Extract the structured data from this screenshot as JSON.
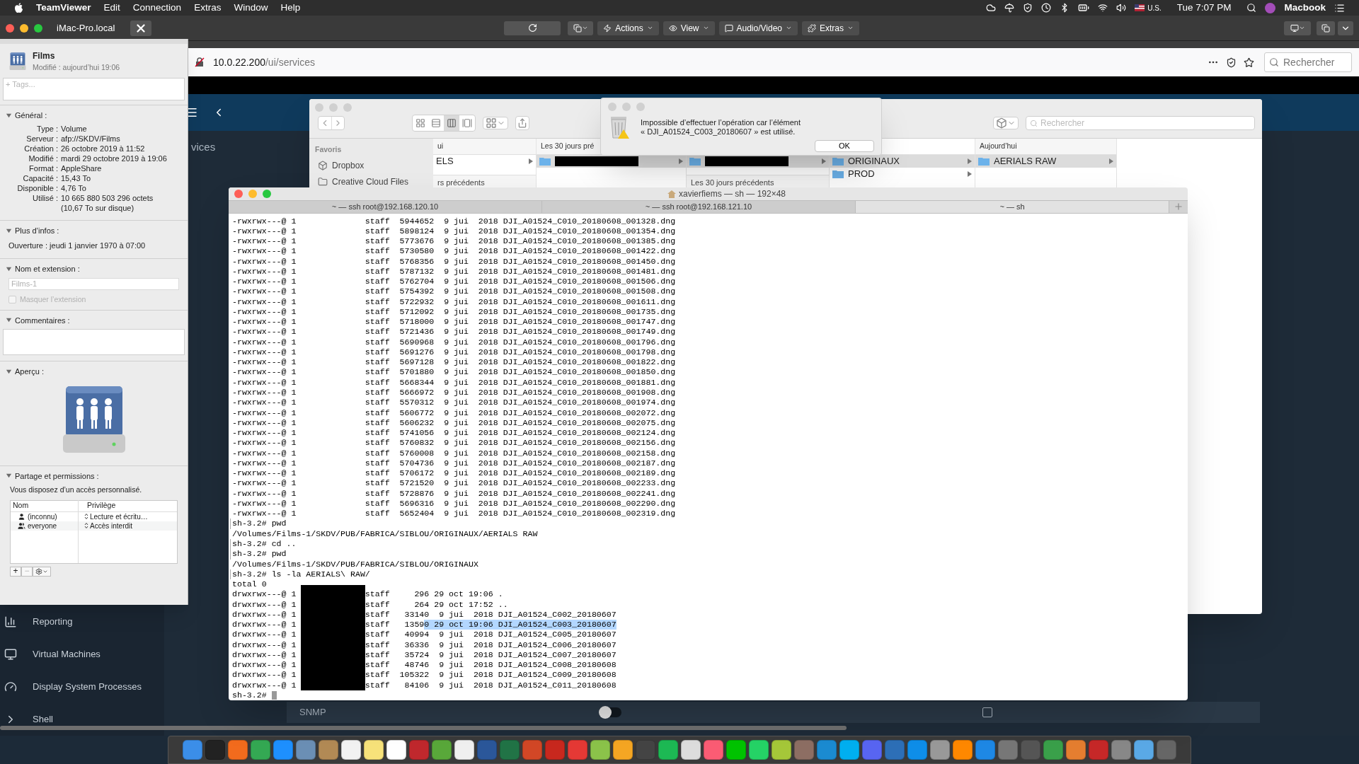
{
  "menubar": {
    "app": "TeamViewer",
    "menus": [
      "Edit",
      "Connection",
      "Extras",
      "Window",
      "Help"
    ],
    "input_source": "U.S.",
    "clock": "Tue 7:07 PM",
    "user": "Macbook"
  },
  "teamviewer": {
    "session_tab": "iMac-Pro.local",
    "actions": [
      "Actions",
      "View",
      "Audio/Video",
      "Extras"
    ]
  },
  "browser": {
    "url_host": "10.0.22.200",
    "url_path": "/ui/services",
    "search_placeholder": "Rechercher"
  },
  "web_app": {
    "page_title": "vices",
    "sidebar": [
      {
        "label": "Reporting"
      },
      {
        "label": "Virtual Machines"
      },
      {
        "label": "Display System Processes"
      },
      {
        "label": "Shell"
      }
    ],
    "snmp_label": "SNMP",
    "snmp_on": false,
    "snmp_checked": false
  },
  "info_window": {
    "name": "Films",
    "modified": "Modifié : aujourd’hui 19:06",
    "tags_placeholder": "+ Tags...",
    "general": {
      "title": "Général :",
      "expanded": true,
      "rows": [
        {
          "label": "Type :",
          "value": "Volume"
        },
        {
          "label": "Serveur :",
          "value": "afp://SKDV/Films"
        },
        {
          "label": "Création :",
          "value": "26 octobre 2019 à 11:52"
        },
        {
          "label": "Modifié :",
          "value": "mardi 29 octobre 2019 à 19:06"
        },
        {
          "label": "Format :",
          "value": "AppleShare"
        },
        {
          "label": "Capacité :",
          "value": "15,43 To"
        },
        {
          "label": "Disponible :",
          "value": "4,76 To"
        },
        {
          "label": "Utilisé :",
          "value": "10 665 880 503 296 octets"
        },
        {
          "value": "(10,67 To sur disque)"
        }
      ]
    },
    "more": {
      "title": "Plus d’infos :",
      "expanded": true,
      "text": "Ouverture : jeudi 1 janvier 1970 à 07:00"
    },
    "name_ext": {
      "title": "Nom et extension :",
      "expanded": true,
      "field_value": "Films-1",
      "hide_label": "Masquer l’extension",
      "hide_checked": false
    },
    "comments": {
      "title": "Commentaires :",
      "expanded": true
    },
    "preview": {
      "title": "Aperçu :",
      "expanded": true
    },
    "sharing": {
      "title": "Partage et permissions :",
      "expanded": true,
      "note": "Vous disposez d’un accès personnalisé.",
      "columns": [
        "Nom",
        "Privilège"
      ],
      "rows": [
        {
          "name": "(inconnu)",
          "privilege": "Lecture et écritu…",
          "kind": "user"
        },
        {
          "name": "everyone",
          "privilege": "Accès interdit",
          "kind": "group"
        }
      ],
      "buttons": [
        "+",
        "−"
      ]
    }
  },
  "finder": {
    "sidebar_heading": "Favoris",
    "sidebar_items": [
      {
        "label": "Dropbox"
      },
      {
        "label": "Creative Cloud Files"
      }
    ],
    "search_placeholder": "Rechercher",
    "columns": [
      {
        "header": "ui",
        "items": [
          {
            "label": "ELS",
            "selected": false
          }
        ],
        "subheader": "rs précédents"
      },
      {
        "header": "Les 30 jours pré",
        "items": [
          {
            "redacted": true,
            "selected": true
          }
        ]
      },
      {
        "items": [
          {
            "redacted": true,
            "selected": true
          }
        ],
        "subheader": "Les 30 jours précédents"
      },
      {
        "items": [
          {
            "label": "ORIGINAUX",
            "selected": true
          },
          {
            "label": "PROD",
            "selected": false
          }
        ]
      },
      {
        "header": "Aujourd’hui",
        "items": [
          {
            "label": "AERIALS RAW",
            "selected": true
          }
        ]
      }
    ]
  },
  "alert": {
    "message": "Impossible d’effectuer l’opération car l’élément\n« DJI_A01524_C003_20180607 » est utilisé.",
    "button": "OK"
  },
  "terminal": {
    "title": "xavierfiems — sh — 192×48",
    "tabs": [
      {
        "label": "~ — ssh root@192.168.120.10",
        "selected": false
      },
      {
        "label": "~ — ssh root@192.168.121.10",
        "selected": false
      },
      {
        "label": "~ — sh",
        "selected": true
      }
    ],
    "lines": [
      {
        "kind": "out",
        "text": "-rwxrwx---@ 1              staff  5944652  9 jui  2018 DJI_A01524_C010_20180608_001328.dng"
      },
      {
        "kind": "out",
        "text": "-rwxrwx---@ 1              staff  5898124  9 jui  2018 DJI_A01524_C010_20180608_001354.dng"
      },
      {
        "kind": "out",
        "text": "-rwxrwx---@ 1              staff  5773676  9 jui  2018 DJI_A01524_C010_20180608_001385.dng"
      },
      {
        "kind": "out",
        "text": "-rwxrwx---@ 1              staff  5730580  9 jui  2018 DJI_A01524_C010_20180608_001422.dng"
      },
      {
        "kind": "out",
        "text": "-rwxrwx---@ 1              staff  5768356  9 jui  2018 DJI_A01524_C010_20180608_001450.dng"
      },
      {
        "kind": "out",
        "text": "-rwxrwx---@ 1              staff  5787132  9 jui  2018 DJI_A01524_C010_20180608_001481.dng"
      },
      {
        "kind": "out",
        "text": "-rwxrwx---@ 1              staff  5762704  9 jui  2018 DJI_A01524_C010_20180608_001506.dng"
      },
      {
        "kind": "out",
        "text": "-rwxrwx---@ 1              staff  5754392  9 jui  2018 DJI_A01524_C010_20180608_001508.dng"
      },
      {
        "kind": "out",
        "text": "-rwxrwx---@ 1              staff  5722932  9 jui  2018 DJI_A01524_C010_20180608_001611.dng"
      },
      {
        "kind": "out",
        "text": "-rwxrwx---@ 1              staff  5712092  9 jui  2018 DJI_A01524_C010_20180608_001735.dng"
      },
      {
        "kind": "out",
        "text": "-rwxrwx---@ 1              staff  5718000  9 jui  2018 DJI_A01524_C010_20180608_001747.dng"
      },
      {
        "kind": "out",
        "text": "-rwxrwx---@ 1              staff  5721436  9 jui  2018 DJI_A01524_C010_20180608_001749.dng"
      },
      {
        "kind": "out",
        "text": "-rwxrwx---@ 1              staff  5690968  9 jui  2018 DJI_A01524_C010_20180608_001796.dng"
      },
      {
        "kind": "out",
        "text": "-rwxrwx---@ 1              staff  5691276  9 jui  2018 DJI_A01524_C010_20180608_001798.dng"
      },
      {
        "kind": "out",
        "text": "-rwxrwx---@ 1              staff  5697128  9 jui  2018 DJI_A01524_C010_20180608_001822.dng"
      },
      {
        "kind": "out",
        "text": "-rwxrwx---@ 1              staff  5701880  9 jui  2018 DJI_A01524_C010_20180608_001850.dng"
      },
      {
        "kind": "out",
        "text": "-rwxrwx---@ 1              staff  5668344  9 jui  2018 DJI_A01524_C010_20180608_001881.dng"
      },
      {
        "kind": "out",
        "text": "-rwxrwx---@ 1              staff  5666972  9 jui  2018 DJI_A01524_C010_20180608_001908.dng"
      },
      {
        "kind": "out",
        "text": "-rwxrwx---@ 1              staff  5570312  9 jui  2018 DJI_A01524_C010_20180608_001974.dng"
      },
      {
        "kind": "out",
        "text": "-rwxrwx---@ 1              staff  5606772  9 jui  2018 DJI_A01524_C010_20180608_002072.dng"
      },
      {
        "kind": "out",
        "text": "-rwxrwx---@ 1              staff  5606232  9 jui  2018 DJI_A01524_C010_20180608_002075.dng"
      },
      {
        "kind": "out",
        "text": "-rwxrwx---@ 1              staff  5741056  9 jui  2018 DJI_A01524_C010_20180608_002124.dng"
      },
      {
        "kind": "out",
        "text": "-rwxrwx---@ 1              staff  5760832  9 jui  2018 DJI_A01524_C010_20180608_002156.dng"
      },
      {
        "kind": "out",
        "text": "-rwxrwx---@ 1              staff  5760008  9 jui  2018 DJI_A01524_C010_20180608_002158.dng"
      },
      {
        "kind": "out",
        "text": "-rwxrwx---@ 1              staff  5704736  9 jui  2018 DJI_A01524_C010_20180608_002187.dng"
      },
      {
        "kind": "out",
        "text": "-rwxrwx---@ 1              staff  5706172  9 jui  2018 DJI_A01524_C010_20180608_002189.dng"
      },
      {
        "kind": "out",
        "text": "-rwxrwx---@ 1              staff  5721520  9 jui  2018 DJI_A01524_C010_20180608_002233.dng"
      },
      {
        "kind": "out",
        "text": "-rwxrwx---@ 1              staff  5728876  9 jui  2018 DJI_A01524_C010_20180608_002241.dng"
      },
      {
        "kind": "out",
        "text": "-rwxrwx---@ 1              staff  5696316  9 jui  2018 DJI_A01524_C010_20180608_002290.dng"
      },
      {
        "kind": "out",
        "text": "-rwxrwx---@ 1              staff  5652404  9 jui  2018 DJI_A01524_C010_20180608_002319.dng"
      },
      {
        "kind": "prompt",
        "text": "sh-3.2# pwd"
      },
      {
        "kind": "out",
        "text": "/Volumes/Films-1/SKDV/PUB/FABRICA/SIBLOU/ORIGINAUX/AERIALS RAW"
      },
      {
        "kind": "prompt",
        "text": "sh-3.2# cd .."
      },
      {
        "kind": "prompt",
        "text": "sh-3.2# pwd"
      },
      {
        "kind": "out",
        "text": "/Volumes/Films-1/SKDV/PUB/FABRICA/SIBLOU/ORIGINAUX"
      },
      {
        "kind": "prompt",
        "text": "sh-3.2# ls -la AERIALS\\ RAW/"
      },
      {
        "kind": "out",
        "text": "total 0"
      }
    ],
    "dir_rows": [
      {
        "left": "drwxrwx---@ 1",
        "right": "staff     296 29 oct 19:06 ."
      },
      {
        "left": "drwxrwx---@ 1",
        "right": "staff     264 29 oct 17:52 .."
      },
      {
        "left": "drwxrwx---@ 1",
        "right": "staff   33140  9 jui  2018 DJI_A01524_C002_20180607"
      },
      {
        "left": "drwxrwx---@ 1",
        "right": "staff   1359",
        "selection": "0 29 oct 19:06 DJI_A01524_C003_20180607"
      },
      {
        "left": "drwxrwx---@ 1",
        "right": "staff   40994  9 jui  2018 DJI_A01524_C005_20180607"
      },
      {
        "left": "drwxrwx---@ 1",
        "right": "staff   36336  9 jui  2018 DJI_A01524_C006_20180607"
      },
      {
        "left": "drwxrwx---@ 1",
        "right": "staff   35724  9 jui  2018 DJI_A01524_C007_20180607"
      },
      {
        "left": "drwxrwx---@ 1",
        "right": "staff   48746  9 jui  2018 DJI_A01524_C008_20180608"
      },
      {
        "left": "drwxrwx---@ 1",
        "right": "staff  105322  9 jui  2018 DJI_A01524_C009_20180608"
      },
      {
        "left": "drwxrwx---@ 1",
        "right": "staff   84106  9 jui  2018 DJI_A01524_C011_20180608"
      }
    ],
    "final_prompt": "sh-3.2#"
  }
}
